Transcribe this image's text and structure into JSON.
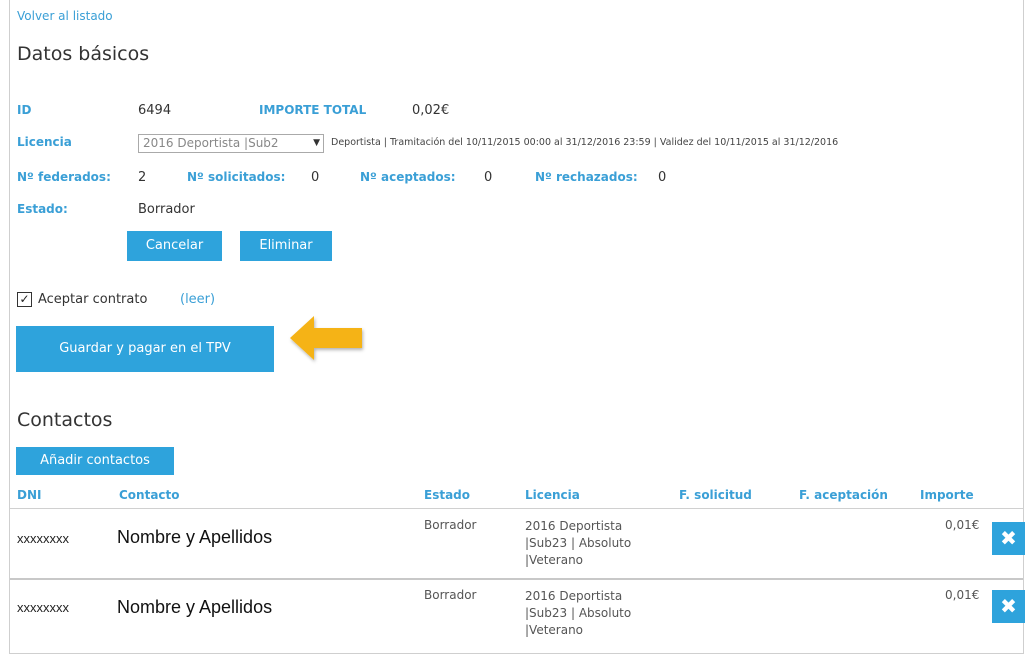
{
  "nav": {
    "back_link": "Volver al listado"
  },
  "basic": {
    "title": "Datos básicos",
    "id_label": "ID",
    "id_value": "6494",
    "total_label": "IMPORTE TOTAL",
    "total_value": "0,02€",
    "license_label": "Licencia",
    "license_select": "2016 Deportista |Sub2",
    "license_info": "Deportista | Tramitación del 10/11/2015 00:00 al 31/12/2016 23:59 | Validez del 10/11/2015 al 31/12/2016",
    "fed_label": "Nº federados:",
    "fed_value": "2",
    "req_label": "Nº solicitados:",
    "req_value": "0",
    "acc_label": "Nº aceptados:",
    "acc_value": "0",
    "rej_label": "Nº rechazados:",
    "rej_value": "0",
    "state_label": "Estado:",
    "state_value": "Borrador",
    "cancel_button": "Cancelar",
    "delete_button": "Eliminar"
  },
  "contract": {
    "checked": true,
    "check_mark": "✓",
    "label": "Aceptar contrato",
    "read_link": "(leer)",
    "pay_button": "Guardar y pagar en el TPV",
    "arrow_color": "#f5b318"
  },
  "contacts": {
    "title": "Contactos",
    "add_button": "Añadir contactos",
    "columns": [
      "DNI",
      "Contacto",
      "Estado",
      "Licencia",
      "F. solicitud",
      "F. aceptación",
      "Importe"
    ],
    "rows": [
      {
        "dni": "xxxxxxxx",
        "name": "Nombre y Apellidos",
        "state": "Borrador",
        "license_lines": [
          "2016 Deportista",
          "|Sub23 | Absoluto",
          "|Veterano"
        ],
        "f_solicitud": "",
        "f_aceptacion": "",
        "amount": "0,01€",
        "delete_icon": "✖"
      },
      {
        "dni": "xxxxxxxx",
        "name": "Nombre y Apellidos",
        "state": "Borrador",
        "license_lines": [
          "2016 Deportista",
          "|Sub23 | Absoluto",
          "|Veterano"
        ],
        "f_solicitud": "",
        "f_aceptacion": "",
        "amount": "0,01€",
        "delete_icon": "✖"
      }
    ]
  },
  "colors": {
    "accent": "#2ea3dc",
    "label_blue": "#3a9fd6",
    "arrow": "#f5b318"
  }
}
